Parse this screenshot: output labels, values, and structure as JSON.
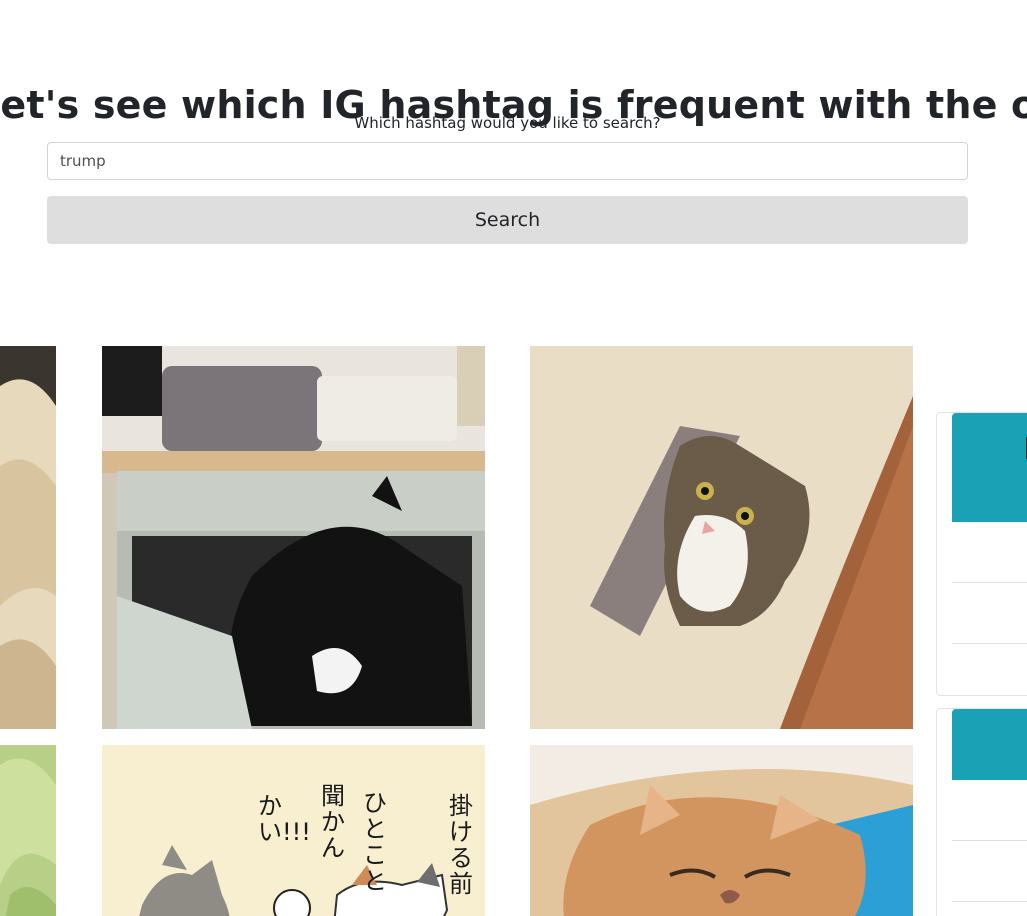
{
  "header": {
    "title": "Let's see which IG hashtag is frequent with the one you choose"
  },
  "search": {
    "label": "Which hashtag would you like to search?",
    "value": "trump",
    "button_label": "Search"
  },
  "gallery": {
    "photos": [
      {
        "subject": "cat lying on beige blanket (cropped)"
      },
      {
        "subject": "black and white cat in fabric storage box under shelf"
      },
      {
        "subject": "tabby cat sitting on carpet next to egg carton"
      },
      {
        "subject": "cat on green background (cropped)"
      },
      {
        "subject": "illustrated cats with Japanese handwritten text"
      },
      {
        "subject": "fluffy orange persian cat sleeping"
      }
    ]
  },
  "illustration_text": [
    "掛ける前",
    "ひとこと",
    "聞かん",
    "かい!!!"
  ],
  "colors": {
    "accent": "#1ba1b6",
    "button_bg": "#dedede",
    "text": "#212529"
  }
}
